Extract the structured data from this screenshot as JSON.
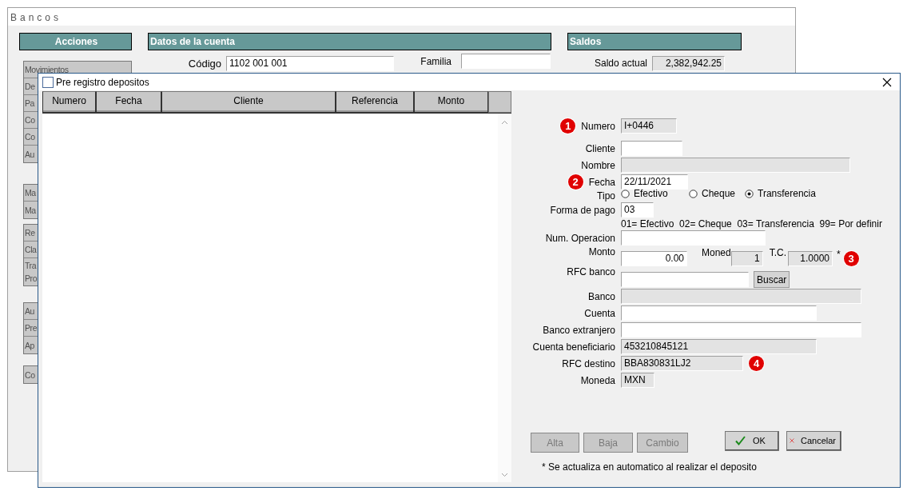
{
  "main_window": {
    "title": "Bancos",
    "sections": [
      "Acciones",
      "Datos de la cuenta",
      "Saldos"
    ],
    "action_groups": [
      [
        "Movimientos",
        "De",
        "Pa",
        "Co",
        "Co",
        "Au"
      ],
      [
        "Ma",
        "Ma"
      ],
      [
        "Re",
        "Cla",
        "Tra\nPro"
      ],
      [
        "Au",
        "Pre",
        "Ap"
      ],
      [
        "Co"
      ]
    ],
    "codigo": {
      "label": "Código",
      "value": "1102 001 001"
    },
    "familia": {
      "label": "Familia"
    },
    "saldo": {
      "label": "Saldo actual",
      "value": "2,382,942.25"
    }
  },
  "dialog": {
    "title": "Pre registro depositos",
    "grid": {
      "columns": [
        "Numero",
        "Fecha",
        "Cliente",
        "Referencia",
        "Monto"
      ]
    },
    "form": [
      {
        "kind": "input",
        "label": "Numero",
        "value": "I+0446",
        "disabled": true,
        "badge": "1"
      },
      {
        "kind": "input",
        "label": "Cliente",
        "disabled": false
      },
      {
        "kind": "input",
        "label": "Nombre",
        "disabled": true
      },
      {
        "kind": "input",
        "label": "Fecha",
        "value": "22/11/2021",
        "disabled": false,
        "badge": "2"
      },
      {
        "kind": "radio",
        "label": "Tipo",
        "options": [
          {
            "label": "Efectivo",
            "selected": false
          },
          {
            "label": "Cheque",
            "selected": false
          },
          {
            "label": "Transferencia",
            "selected": true
          }
        ]
      },
      {
        "kind": "input",
        "label": "Forma de pago",
        "value": "03",
        "disabled": false
      },
      {
        "kind": "hint",
        "text": "01= Efectivo  02= Cheque  03= Transferencia  99= Por definir"
      },
      {
        "kind": "input",
        "label": "Num. Operacion",
        "disabled": false
      },
      {
        "kind": "monto",
        "label": "Monto",
        "value": "0.00",
        "moned_label": "Moned",
        "moned_value": "1",
        "tc_label": "T.C.",
        "tc_value": "1.0000",
        "note_mark": "*",
        "badge": "3"
      },
      {
        "kind": "search",
        "label": "RFC banco",
        "button": "Buscar"
      },
      {
        "kind": "input",
        "label": "Banco",
        "disabled": true
      },
      {
        "kind": "input",
        "label": "Cuenta",
        "disabled": false
      },
      {
        "kind": "input",
        "label": "Banco extranjero",
        "disabled": false
      },
      {
        "kind": "input",
        "label": "Cuenta beneficiario",
        "value": "453210845121",
        "disabled": true
      },
      {
        "kind": "input",
        "label": "RFC destino",
        "value": "BBA830831LJ2",
        "disabled": true,
        "badge": "4"
      },
      {
        "kind": "input",
        "label": "Moneda",
        "value": "MXN",
        "disabled": true
      }
    ],
    "edit_buttons": [
      {
        "label": "Alta",
        "disabled": true
      },
      {
        "label": "Baja",
        "disabled": true
      },
      {
        "label": "Cambio",
        "disabled": true
      }
    ],
    "ok_button": "OK",
    "cancel_button": "Cancelar",
    "footnote": "* Se actualiza en automatico al realizar el deposito"
  }
}
